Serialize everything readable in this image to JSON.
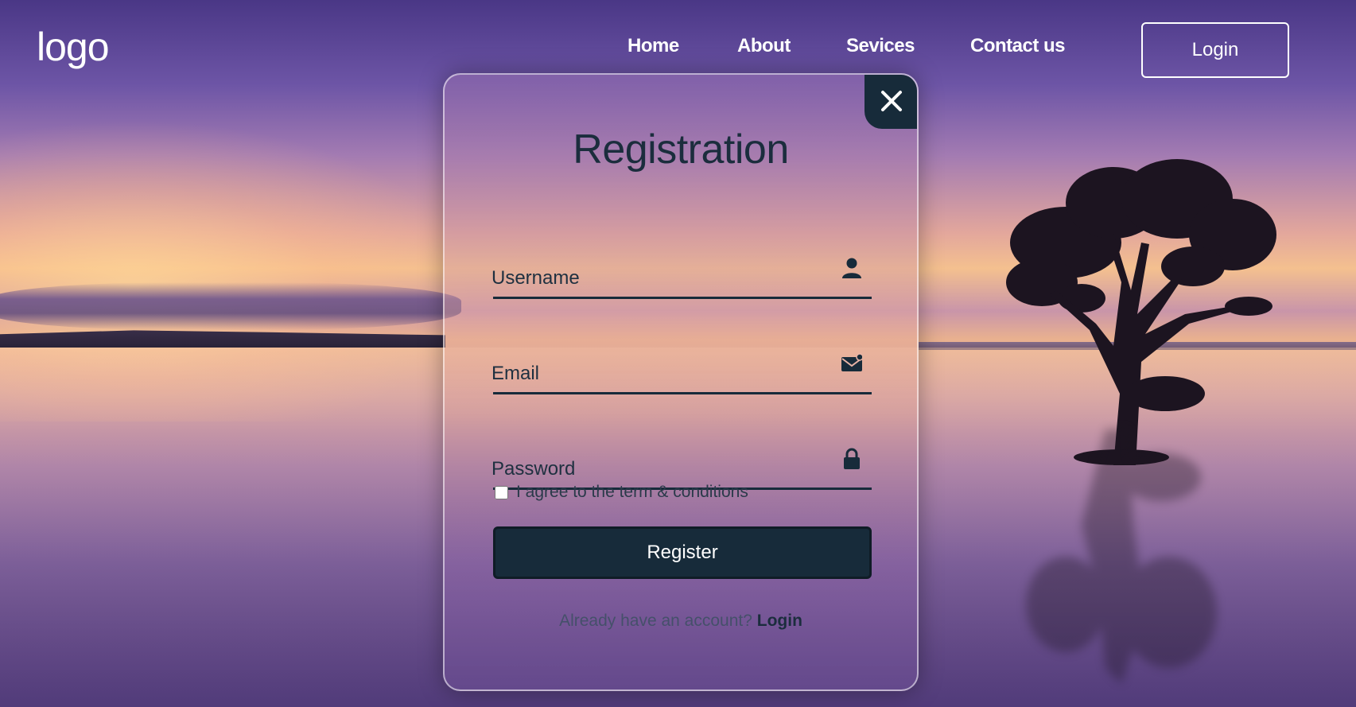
{
  "header": {
    "logo": "logo",
    "nav": [
      "Home",
      "About",
      "Sevices",
      "Contact us"
    ],
    "login_label": "Login"
  },
  "modal": {
    "title": "Registration",
    "fields": [
      {
        "placeholder": "Username",
        "icon": "person-icon"
      },
      {
        "placeholder": "Email",
        "icon": "envelope-icon"
      },
      {
        "placeholder": "Password",
        "icon": "lock-icon"
      }
    ],
    "agree_text": "I agree to the term & conditions",
    "agree_checked": false,
    "register_label": "Register",
    "already_text": "Already have an account?",
    "login_link": "Login",
    "close_icon": "close-icon"
  },
  "colors": {
    "accent": "#172b3a",
    "text_dark": "#1b2d3d",
    "white": "#ffffff"
  }
}
